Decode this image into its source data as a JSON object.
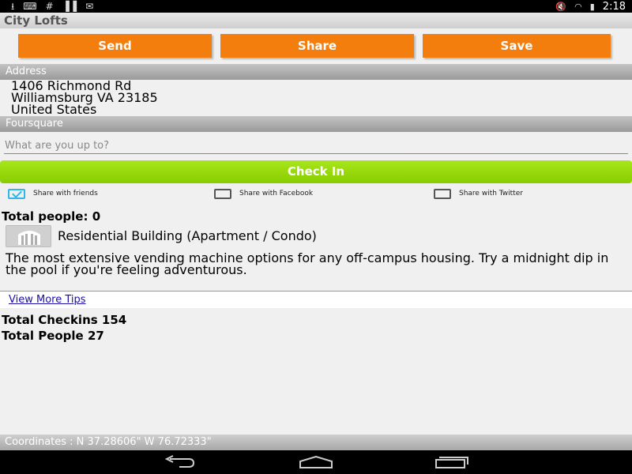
{
  "status_bar": {
    "time": "2:18",
    "left_icons": [
      "download-icon",
      "keyboard-icon",
      "hashtag-icon",
      "barcode-icon",
      "mail-icon"
    ],
    "right_icons": [
      "mute-icon",
      "wifi-icon",
      "battery-icon"
    ]
  },
  "app": {
    "title": "City Lofts"
  },
  "actions": {
    "send": "Send",
    "share": "Share",
    "save": "Save",
    "color": "#f47e0d"
  },
  "address": {
    "header": "Address",
    "line1": "1406 Richmond Rd",
    "line2": "Williamsburg VA 23185",
    "line3": "United States"
  },
  "foursquare": {
    "header": "Foursquare",
    "input_placeholder": "What are you up to?",
    "checkin_label": "Check In",
    "checkin_color": "#99dd00",
    "share_options": [
      {
        "label": "Share with friends",
        "checked": true
      },
      {
        "label": "Share with Facebook",
        "checked": false
      },
      {
        "label": "Share with Twitter",
        "checked": false
      }
    ],
    "total_people_now": "Total people: 0",
    "venue_icon": "building-icon",
    "venue_type": "Residential Building (Apartment / Condo)",
    "tip": "The most extensive vending machine options for any off-campus housing. Try a midnight dip in the pool if you're feeling adventurous.",
    "view_more_tips": "View More Tips",
    "total_checkins": "Total Checkins 154",
    "total_people": "Total People 27"
  },
  "coordinates": "Coordinates : N 37.28606\" W 76.72333\"",
  "nav": {
    "icons": [
      "back-icon",
      "home-icon",
      "recent-apps-icon"
    ]
  }
}
